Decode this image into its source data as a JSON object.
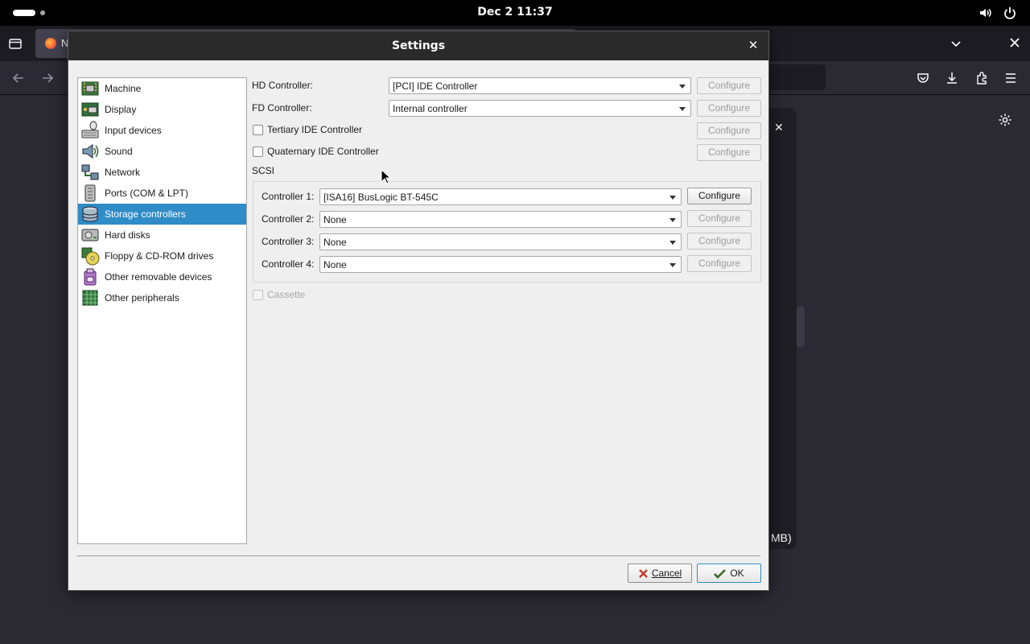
{
  "topbar": {
    "clock": "Dec 2  11:37",
    "icons": [
      "volume-icon",
      "power-icon"
    ]
  },
  "browser": {
    "tab_title": "N",
    "side_panel_text": "MB)"
  },
  "dialog": {
    "title": "Settings",
    "categories": [
      {
        "label": "Machine",
        "icon": "machine-icon"
      },
      {
        "label": "Display",
        "icon": "display-icon"
      },
      {
        "label": "Input devices",
        "icon": "input-devices-icon"
      },
      {
        "label": "Sound",
        "icon": "sound-icon"
      },
      {
        "label": "Network",
        "icon": "network-icon"
      },
      {
        "label": "Ports (COM & LPT)",
        "icon": "ports-icon"
      },
      {
        "label": "Storage controllers",
        "icon": "storage-icon",
        "selected": true
      },
      {
        "label": "Hard disks",
        "icon": "hard-disk-icon"
      },
      {
        "label": "Floppy & CD-ROM drives",
        "icon": "floppy-cdrom-icon"
      },
      {
        "label": "Other removable devices",
        "icon": "removable-icon"
      },
      {
        "label": "Other peripherals",
        "icon": "peripherals-icon"
      }
    ],
    "hd_controller": {
      "label": "HD Controller:",
      "value": "[PCI] IDE Controller"
    },
    "fd_controller": {
      "label": "FD Controller:",
      "value": "Internal controller"
    },
    "tertiary_ide": {
      "label": "Tertiary IDE Controller",
      "checked": false
    },
    "quaternary_ide": {
      "label": "Quaternary IDE Controller",
      "checked": false
    },
    "scsi": {
      "group_label": "SCSI",
      "controllers": [
        {
          "label": "Controller 1:",
          "value": "[ISA16] BusLogic BT-545C",
          "configure_enabled": true
        },
        {
          "label": "Controller 2:",
          "value": "None",
          "configure_enabled": false
        },
        {
          "label": "Controller 3:",
          "value": "None",
          "configure_enabled": false
        },
        {
          "label": "Controller 4:",
          "value": "None",
          "configure_enabled": false
        }
      ]
    },
    "cassette": {
      "label": "Cassette",
      "checked": false,
      "enabled": false
    },
    "configure_label": "Configure",
    "cancel_label": "Cancel",
    "ok_label": "OK",
    "colors": {
      "selection": "#308cc6",
      "titlebar": "#2a2a2a",
      "dialog_bg": "#efefef"
    }
  }
}
